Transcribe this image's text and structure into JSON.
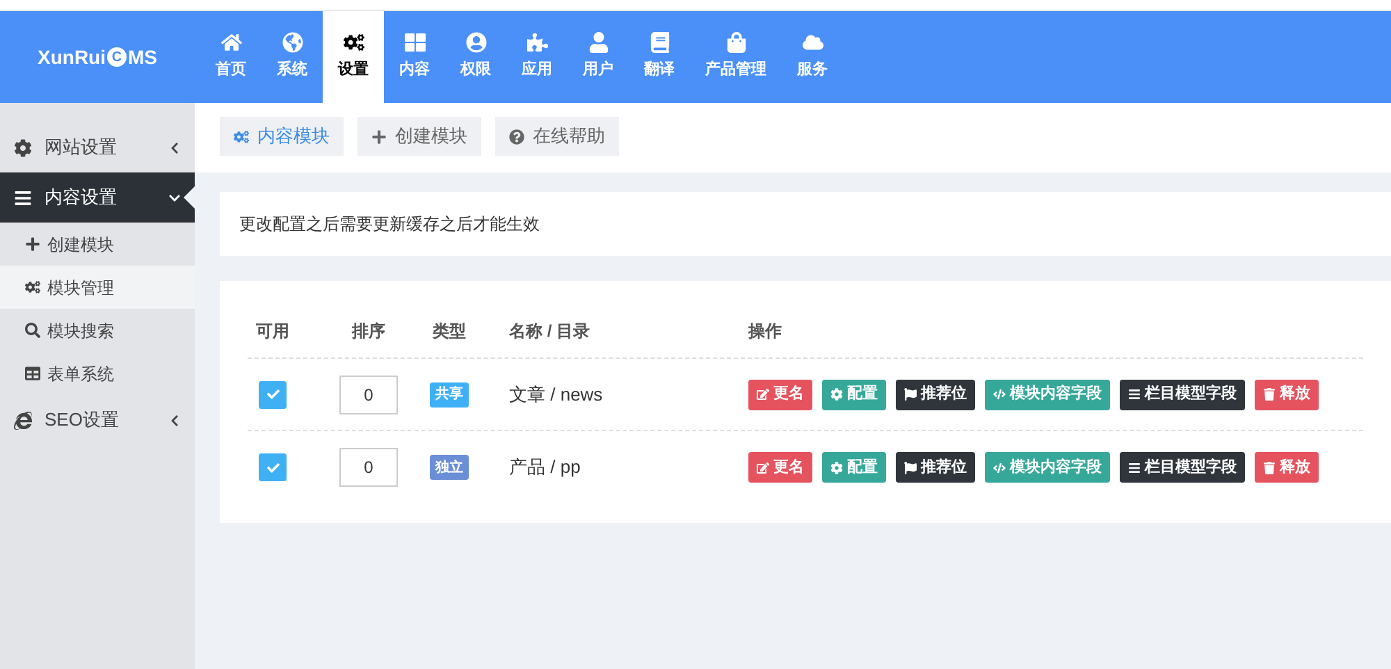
{
  "logo": {
    "text_before": "XunRui",
    "letter": "C",
    "text_after": "MS"
  },
  "top_nav": [
    {
      "label": "首页",
      "selected": false
    },
    {
      "label": "系统",
      "selected": false
    },
    {
      "label": "设置",
      "selected": true
    },
    {
      "label": "内容",
      "selected": false
    },
    {
      "label": "权限",
      "selected": false
    },
    {
      "label": "应用",
      "selected": false
    },
    {
      "label": "用户",
      "selected": false
    },
    {
      "label": "翻译",
      "selected": false
    },
    {
      "label": "产品管理",
      "selected": false
    },
    {
      "label": "服务",
      "selected": false
    }
  ],
  "sidebar": {
    "items": [
      {
        "label": "网站设置",
        "expanded": false
      },
      {
        "label": "内容设置",
        "expanded": true,
        "children": [
          {
            "label": "创建模块",
            "selected": false
          },
          {
            "label": "模块管理",
            "selected": true
          },
          {
            "label": "模块搜索",
            "selected": false
          },
          {
            "label": "表单系统",
            "selected": false
          }
        ]
      },
      {
        "label": "SEO设置",
        "expanded": false
      }
    ]
  },
  "toolbar": [
    {
      "label": "内容模块",
      "selected": true
    },
    {
      "label": "创建模块",
      "selected": false
    },
    {
      "label": "在线帮助",
      "selected": false
    }
  ],
  "notice": "更改配置之后需要更新缓存之后才能生效",
  "table": {
    "columns": [
      "可用",
      "排序",
      "类型",
      "名称 / 目录",
      "操作"
    ],
    "rows": [
      {
        "checked": true,
        "order": "0",
        "type": {
          "label": "共享",
          "color": "#3fb0f5"
        },
        "name": "文章 / news",
        "actions": [
          {
            "label": "更名",
            "kind": "danger"
          },
          {
            "label": "配置",
            "kind": "success"
          },
          {
            "label": "推荐位",
            "kind": "dark"
          },
          {
            "label": "模块内容字段",
            "kind": "success"
          },
          {
            "label": "栏目模型字段",
            "kind": "dark"
          },
          {
            "label": "释放",
            "kind": "danger"
          }
        ]
      },
      {
        "checked": true,
        "order": "0",
        "type": {
          "label": "独立",
          "color": "#6b8fd6"
        },
        "name": "产品 / pp",
        "actions": [
          {
            "label": "更名",
            "kind": "danger"
          },
          {
            "label": "配置",
            "kind": "success"
          },
          {
            "label": "推荐位",
            "kind": "dark"
          },
          {
            "label": "模块内容字段",
            "kind": "success"
          },
          {
            "label": "栏目模型字段",
            "kind": "dark"
          },
          {
            "label": "释放",
            "kind": "danger"
          }
        ]
      }
    ]
  }
}
